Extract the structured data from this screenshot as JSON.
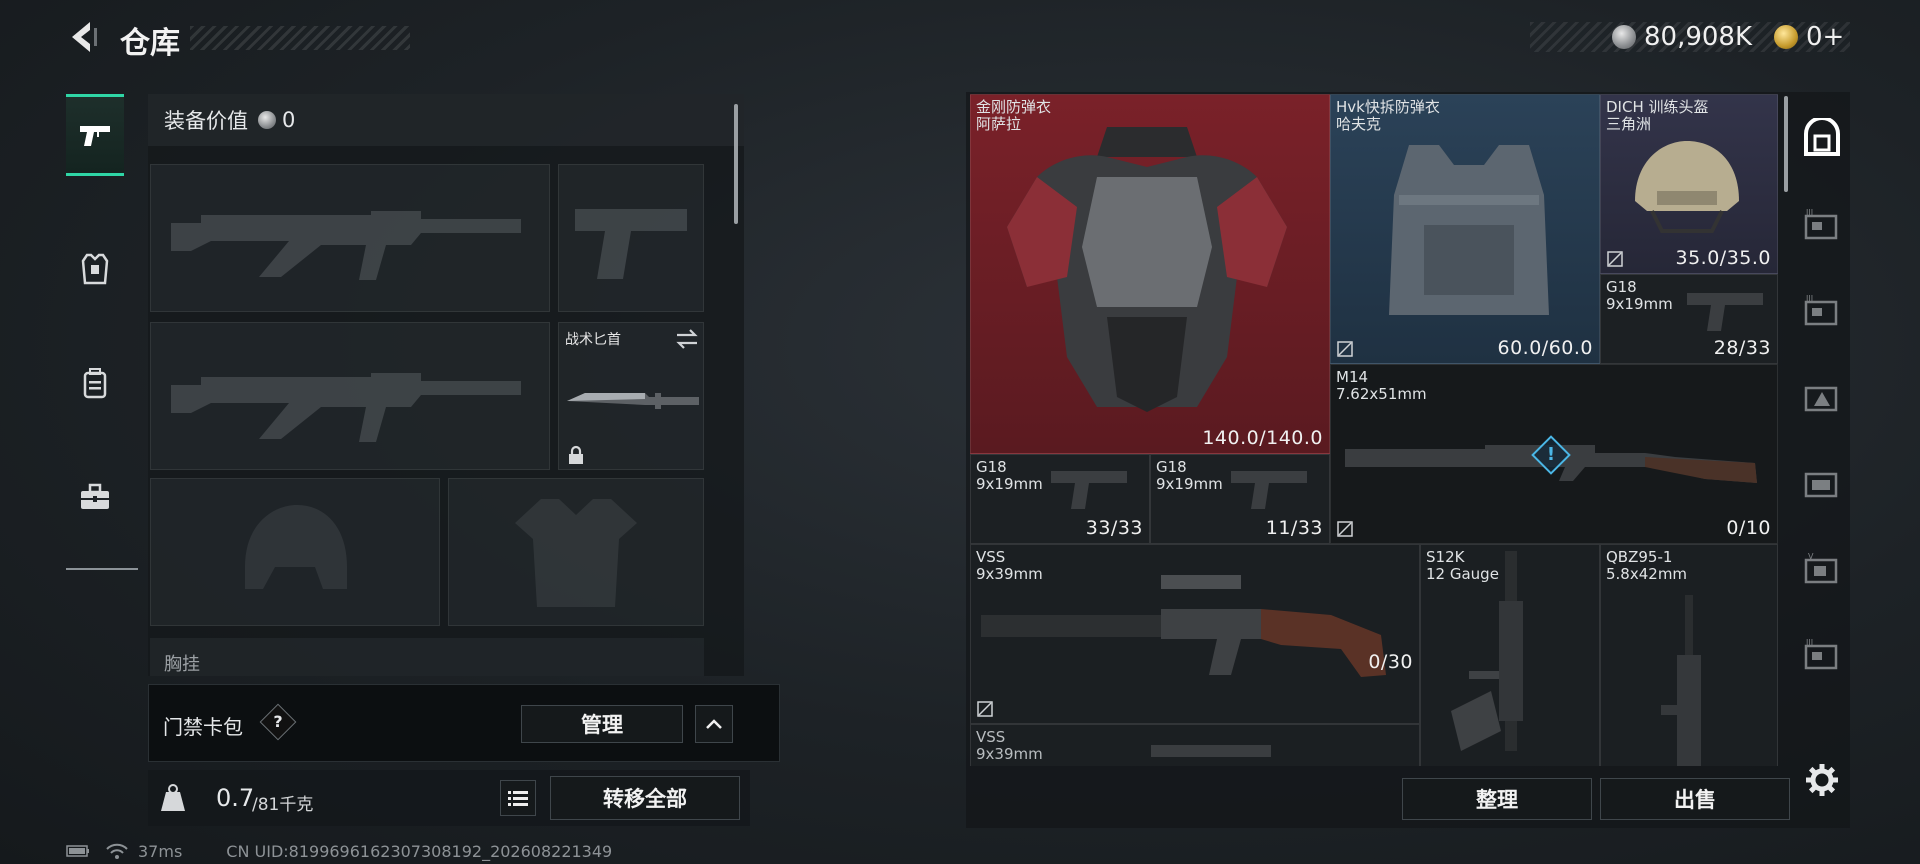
{
  "header": {
    "title": "仓库",
    "silver_amount": "80,908K",
    "gold_amount": "0+"
  },
  "loadout": {
    "equip_value_label": "装备价值",
    "equip_value": "0",
    "knife_name": "战术匕首",
    "chest_rig_label": "胸挂",
    "keycard_label": "门禁卡包",
    "help_mark": "?",
    "manage_label": "管理",
    "weight_current": "0.7",
    "weight_max": "/81千克",
    "transfer_all_label": "转移全部"
  },
  "inventory": {
    "items": [
      {
        "line1": "金刚防弹衣",
        "line2": "阿萨拉",
        "count": "140.0/140.0"
      },
      {
        "line1": "Hvk快拆防弹衣",
        "line2": "哈夫克",
        "count": "60.0/60.0"
      },
      {
        "line1": "DICH 训练头盔",
        "line2": "三角洲",
        "count": "35.0/35.0"
      },
      {
        "line1": "G18",
        "line2": "9x19mm",
        "count": "28/33"
      },
      {
        "line1": "M14",
        "line2": "7.62x51mm",
        "count": "0/10"
      },
      {
        "line1": "G18",
        "line2": "9x19mm",
        "count": "33/33"
      },
      {
        "line1": "G18",
        "line2": "9x19mm",
        "count": "11/33"
      },
      {
        "line1": "VSS",
        "line2": "9x39mm",
        "count": "0/30"
      },
      {
        "line1": "S12K",
        "line2": "12 Gauge",
        "count": ""
      },
      {
        "line1": "QBZ95-1",
        "line2": "5.8x42mm",
        "count": ""
      },
      {
        "line1": "VSS",
        "line2": "9x39mm",
        "count": ""
      }
    ],
    "sort_label": "整理",
    "sell_label": "出售",
    "alert_mark": "!"
  },
  "status_bar": {
    "ping": "37ms",
    "uid": "CN UID:8199696162307308192_202608221349"
  },
  "icons": {
    "left_rail": [
      "pistol-icon",
      "armor-icon",
      "backpack-icon",
      "toolbox-icon"
    ],
    "right_rail": [
      "safe-box-icon",
      "storage-tab-icon",
      "storage-tab-icon",
      "storage-tab-icon",
      "storage-tab-icon",
      "storage-tab-icon",
      "storage-tab-icon",
      "settings-gear-icon"
    ]
  },
  "colors": {
    "accent": "#2fd6a6",
    "rare_red": "#6a1e25",
    "rare_blue": "#253849",
    "rare_purple": "#2a2b3c"
  }
}
